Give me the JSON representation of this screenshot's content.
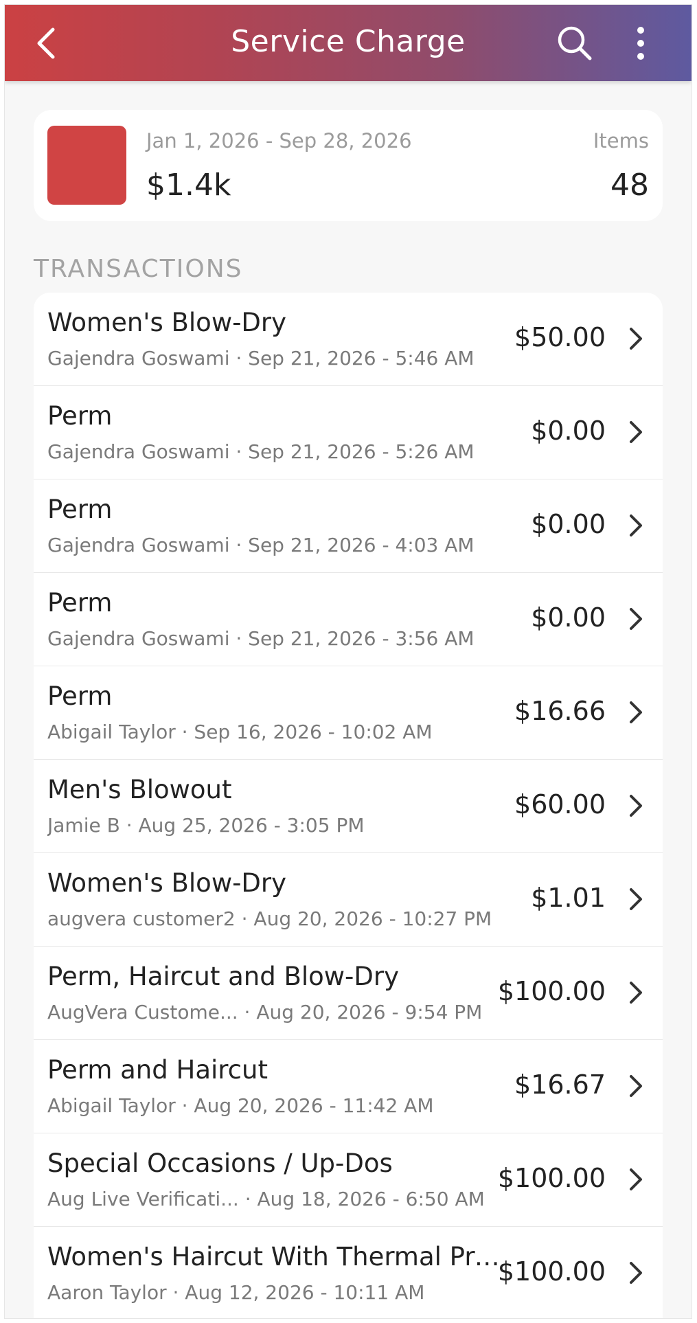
{
  "header": {
    "title": "Service Charge"
  },
  "summary": {
    "date_range": "Jan 1, 2026 - Sep 28, 2026",
    "total": "$1.4k",
    "items_label": "Items",
    "items_count": "48",
    "swatch_color": "#d04444"
  },
  "section": {
    "label": "TRANSACTIONS"
  },
  "transactions": [
    {
      "title": "Women's Blow-Dry",
      "subtitle": "Gajendra Goswami · Sep 21, 2026 - 5:46 AM",
      "amount": "$50.00"
    },
    {
      "title": "Perm",
      "subtitle": "Gajendra Goswami · Sep 21, 2026 - 5:26 AM",
      "amount": "$0.00"
    },
    {
      "title": "Perm",
      "subtitle": "Gajendra Goswami · Sep 21, 2026 - 4:03 AM",
      "amount": "$0.00"
    },
    {
      "title": "Perm",
      "subtitle": "Gajendra Goswami · Sep 21, 2026 - 3:56 AM",
      "amount": "$0.00"
    },
    {
      "title": "Perm",
      "subtitle": "Abigail Taylor · Sep 16, 2026 - 10:02 AM",
      "amount": "$16.66"
    },
    {
      "title": "Men's Blowout",
      "subtitle": "Jamie B · Aug 25, 2026 - 3:05 PM",
      "amount": "$60.00"
    },
    {
      "title": "Women's Blow-Dry",
      "subtitle": "augvera customer2 · Aug 20, 2026 - 10:27 PM",
      "amount": "$1.01"
    },
    {
      "title": "Perm, Haircut and Blow-Dry",
      "subtitle": "AugVera Custome... · Aug 20, 2026 - 9:54 PM",
      "amount": "$100.00"
    },
    {
      "title": "Perm and Haircut",
      "subtitle": "Abigail Taylor · Aug 20, 2026 - 11:42 AM",
      "amount": "$16.67"
    },
    {
      "title": "Special Occasions / Up-Dos",
      "subtitle": "Aug Live Verificati... · Aug 18, 2026 - 6:50 AM",
      "amount": "$100.00"
    },
    {
      "title": "Women's Haircut With Thermal Pre...",
      "subtitle": "Aaron Taylor · Aug 12, 2026 - 10:11 AM",
      "amount": "$100.00"
    }
  ],
  "icons": {
    "back": "chevron-left-icon",
    "search": "search-icon",
    "more": "more-vertical-icon",
    "row_chevron": "chevron-right-icon"
  },
  "colors": {
    "header_gradient_start": "#cb4143",
    "header_gradient_end": "#5e5aa0",
    "accent_swatch": "#d04444"
  }
}
